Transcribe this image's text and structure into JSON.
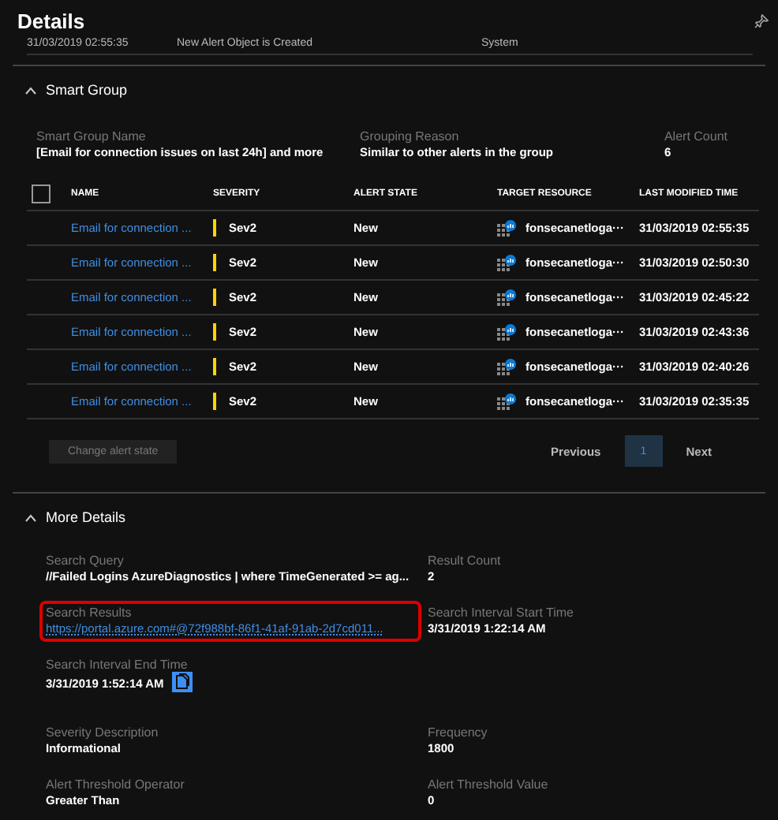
{
  "panel": {
    "title": "Details"
  },
  "history_row": [
    "31/03/2019 02:55:35",
    "New Alert Object is Created",
    "System"
  ],
  "smart_group": {
    "title": "Smart Group",
    "expanded": true,
    "fields": [
      {
        "label": "Smart Group Name",
        "value": "[Email for connection issues on last 24h] and more"
      },
      {
        "label": "Grouping Reason",
        "value": "Similar to other alerts in the group"
      },
      {
        "label": "Alert Count",
        "value": "6"
      }
    ],
    "table": {
      "select_all": false,
      "columns": [
        "NAME",
        "SEVERITY",
        "ALERT STATE",
        "TARGET RESOURCE",
        "LAST MODIFIED TIME"
      ],
      "rows": [
        {
          "name": "Email for connection ...",
          "severity": "Sev2",
          "state": "New",
          "resource": "fonsecanetloga···",
          "time": "31/03/2019 02:55:35"
        },
        {
          "name": "Email for connection ...",
          "severity": "Sev2",
          "state": "New",
          "resource": "fonsecanetloga···",
          "time": "31/03/2019 02:50:30"
        },
        {
          "name": "Email for connection ...",
          "severity": "Sev2",
          "state": "New",
          "resource": "fonsecanetloga···",
          "time": "31/03/2019 02:45:22"
        },
        {
          "name": "Email for connection ...",
          "severity": "Sev2",
          "state": "New",
          "resource": "fonsecanetloga···",
          "time": "31/03/2019 02:43:36"
        },
        {
          "name": "Email for connection ...",
          "severity": "Sev2",
          "state": "New",
          "resource": "fonsecanetloga···",
          "time": "31/03/2019 02:40:26"
        },
        {
          "name": "Email for connection ...",
          "severity": "Sev2",
          "state": "New",
          "resource": "fonsecanetloga···",
          "time": "31/03/2019 02:35:35"
        }
      ]
    },
    "action": {
      "label": "Change alert state",
      "disabled": true
    },
    "pagination": {
      "previous": "Previous",
      "pages": [
        {
          "label": "1",
          "selected": true
        }
      ],
      "next": "Next"
    }
  },
  "more_details": {
    "title": "More Details",
    "expanded": true,
    "fields": [
      {
        "label": "Search Query",
        "value": "//Failed Logins AzureDiagnostics | where TimeGenerated >= ag...",
        "kind": "text"
      },
      {
        "label": "Result Count",
        "value": "2",
        "kind": "text"
      },
      {
        "label": "Search Results",
        "value": "https://portal.azure.com#@72f988bf-86f1-41af-91ab-2d7cd011...",
        "kind": "link",
        "highlighted": true
      },
      {
        "label": "Search Interval Start Time",
        "value": "3/31/2019 1:22:14 AM",
        "kind": "text"
      },
      {
        "label": "Search Interval End Time",
        "value": "3/31/2019 1:52:14 AM",
        "kind": "copyable"
      },
      {
        "label": "Severity Description",
        "value": "Informational",
        "kind": "text"
      },
      {
        "label": "Frequency",
        "value": "1800",
        "kind": "text"
      },
      {
        "label": "Alert Threshold Operator",
        "value": "Greater Than",
        "kind": "text"
      },
      {
        "label": "Alert Threshold Value",
        "value": "0",
        "kind": "text"
      }
    ]
  }
}
